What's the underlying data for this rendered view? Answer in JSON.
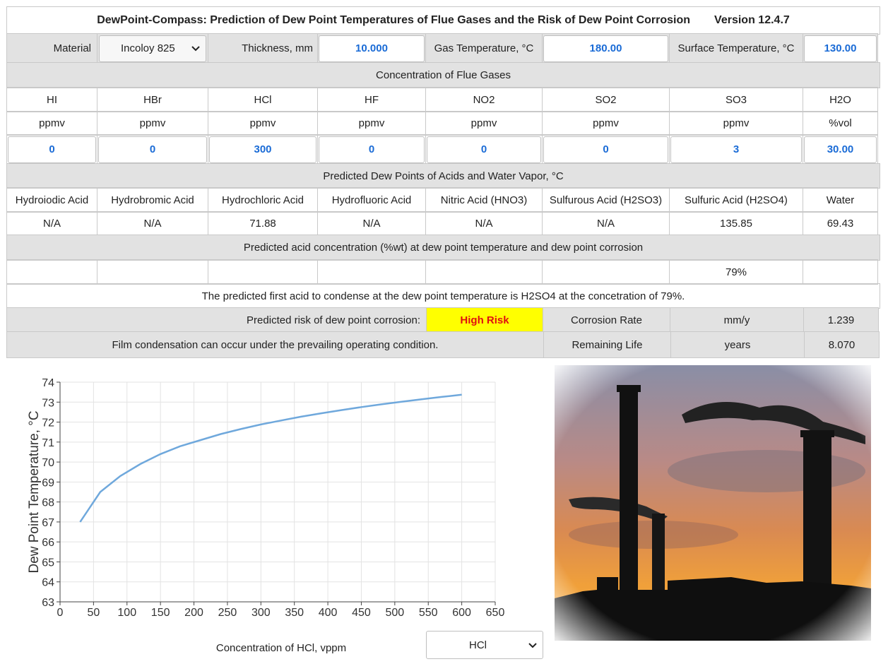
{
  "header": {
    "title": "DewPoint-Compass: Prediction of Dew Point Temperatures of Flue Gases and the Risk of Dew Point Corrosion",
    "version": "Version 12.4.7"
  },
  "inputs": {
    "material_label": "Material",
    "material_value": "Incoloy 825",
    "thickness_label": "Thickness, mm",
    "thickness_value": "10.000",
    "gas_temp_label": "Gas Temperature, °C",
    "gas_temp_value": "180.00",
    "surface_temp_label": "Surface Temperature, °C",
    "surface_temp_value": "130.00"
  },
  "flue_gases": {
    "section_title": "Concentration of Flue Gases",
    "species": [
      {
        "name": "HI",
        "unit": "ppmv",
        "value": "0"
      },
      {
        "name": "HBr",
        "unit": "ppmv",
        "value": "0"
      },
      {
        "name": "HCl",
        "unit": "ppmv",
        "value": "300"
      },
      {
        "name": "HF",
        "unit": "ppmv",
        "value": "0"
      },
      {
        "name": "NO2",
        "unit": "ppmv",
        "value": "0"
      },
      {
        "name": "SO2",
        "unit": "ppmv",
        "value": "0"
      },
      {
        "name": "SO3",
        "unit": "ppmv",
        "value": "3"
      },
      {
        "name": "H2O",
        "unit": "%vol",
        "value": "30.00"
      }
    ]
  },
  "dew_points": {
    "section_title": "Predicted Dew Points of Acids and Water Vapor, °C",
    "acids": [
      {
        "name": "Hydroiodic Acid",
        "value": "N/A"
      },
      {
        "name": "Hydrobromic Acid",
        "value": "N/A"
      },
      {
        "name": "Hydrochloric Acid",
        "value": "71.88"
      },
      {
        "name": "Hydrofluoric Acid",
        "value": "N/A"
      },
      {
        "name": "Nitric Acid (HNO3)",
        "value": "N/A"
      },
      {
        "name": "Sulfurous Acid (H2SO3)",
        "value": "N/A"
      },
      {
        "name": "Sulfuric Acid (H2SO4)",
        "value": "135.85"
      },
      {
        "name": "Water",
        "value": "69.43"
      }
    ]
  },
  "acid_concentration": {
    "section_title": "Predicted acid concentration (%wt) at dew point temperature and dew point corrosion",
    "values": [
      "",
      "",
      "",
      "",
      "",
      "",
      "79%",
      ""
    ]
  },
  "messages": {
    "first_acid": "The predicted first acid to condense at the dew point temperature is H2SO4 at the concetration of 79%.",
    "risk_label": "Predicted risk of dew point corrosion:",
    "risk_value": "High Risk",
    "film": "Film condensation can occur under the prevailing operating condition."
  },
  "corrosion": {
    "rate_label": "Corrosion Rate",
    "rate_unit": "mm/y",
    "rate_value": "1.239",
    "life_label": "Remaining Life",
    "life_unit": "years",
    "life_value": "8.070"
  },
  "chart_select": {
    "value": "HCl"
  },
  "colors": {
    "input_text": "#1a6bd6",
    "risk_bg": "#ffff00",
    "risk_text": "#e01010",
    "line": "#6fa8dc"
  },
  "chart_data": {
    "type": "line",
    "xlabel": "Concentration of HCl, vppm",
    "ylabel": "Dew Point Temperature, °C",
    "xlim": [
      0,
      650
    ],
    "ylim": [
      63,
      74
    ],
    "xticks": [
      0,
      50,
      100,
      150,
      200,
      250,
      300,
      350,
      400,
      450,
      500,
      550,
      600,
      650
    ],
    "yticks": [
      63,
      64,
      65,
      66,
      67,
      68,
      69,
      70,
      71,
      72,
      73,
      74
    ],
    "grid": true,
    "series": [
      {
        "x": [
          30,
          60,
          90,
          120,
          150,
          180,
          210,
          240,
          270,
          300,
          330,
          360,
          390,
          420,
          450,
          480,
          510,
          540,
          570,
          600
        ],
        "y": [
          67.0,
          68.5,
          69.3,
          69.9,
          70.4,
          70.8,
          71.1,
          71.4,
          71.65,
          71.88,
          72.08,
          72.27,
          72.44,
          72.6,
          72.75,
          72.89,
          73.02,
          73.14,
          73.26,
          73.37
        ]
      }
    ]
  }
}
